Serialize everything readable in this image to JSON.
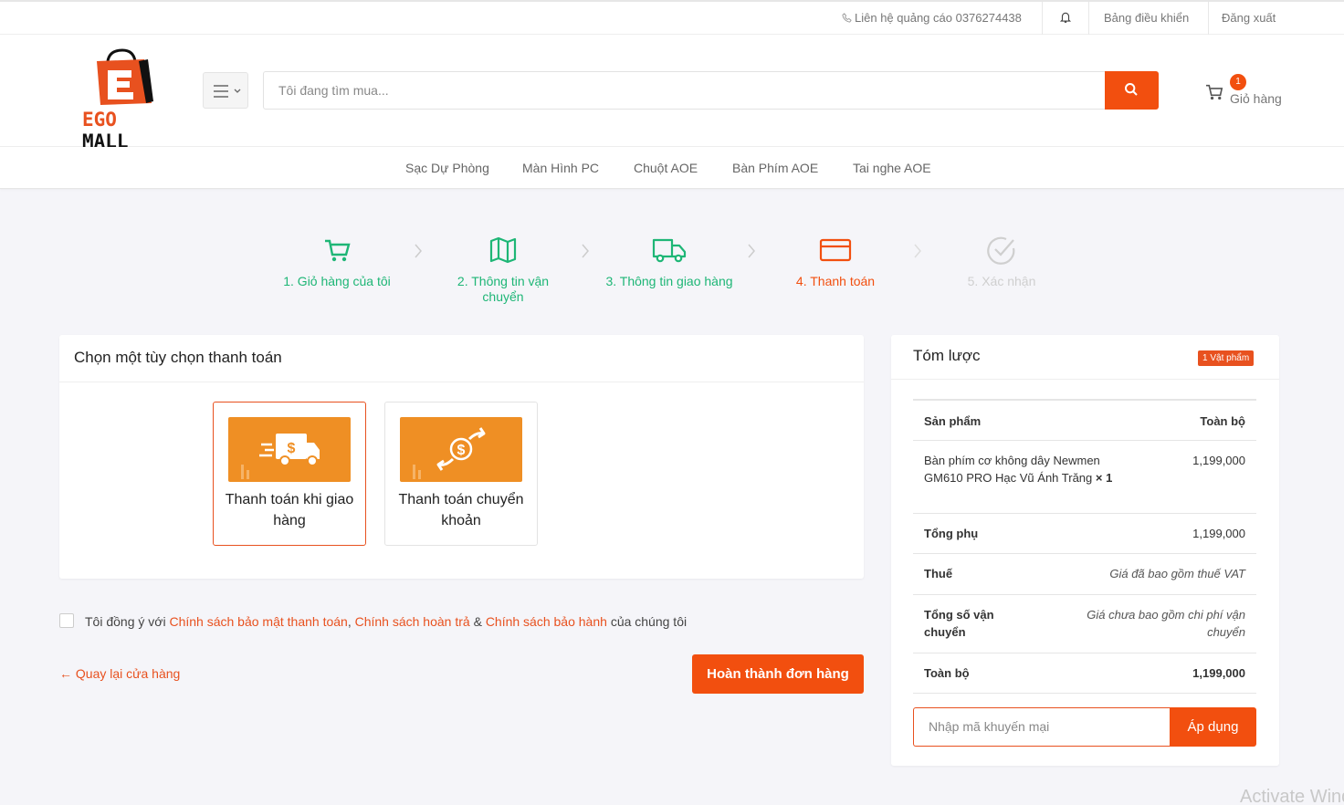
{
  "topbar": {
    "contact": "Liên hệ quảng cáo 0376274438",
    "dashboard": "Bảng điều khiển",
    "logout": "Đăng xuất",
    "icons": [
      "phone-icon",
      "bell-icon"
    ]
  },
  "header": {
    "logo": {
      "brand_a": "EGO",
      "brand_b": "MALL"
    },
    "search": {
      "placeholder": "Tôi đang tìm mua..."
    },
    "cart": {
      "count": "1",
      "label": "Giỏ hàng"
    }
  },
  "nav": {
    "items": [
      "Sạc Dự Phòng",
      "Màn Hình PC",
      "Chuột AOE",
      "Bàn Phím AOE",
      "Tai nghe AOE"
    ]
  },
  "steps": {
    "items": [
      {
        "label": "1. Giỏ hàng của tôi",
        "status": "done",
        "icon": "cart-icon"
      },
      {
        "label": "2. Thông tin vận chuyển",
        "status": "done",
        "icon": "map-icon"
      },
      {
        "label": "3. Thông tin giao hàng",
        "status": "done",
        "icon": "truck-icon"
      },
      {
        "label": "4. Thanh toán",
        "status": "active",
        "icon": "credit-card-icon"
      },
      {
        "label": "5. Xác nhận",
        "status": "pending",
        "icon": "check-circle-icon"
      }
    ]
  },
  "payment": {
    "title": "Chọn một tùy chọn thanh toán",
    "options": [
      {
        "label": "Thanh toán khi giao hàng",
        "selected": true,
        "icon": "cash-truck-icon"
      },
      {
        "label": "Thanh toán chuyển khoản",
        "selected": false,
        "icon": "money-transfer-icon"
      }
    ]
  },
  "agree": {
    "prefix": "Tôi đồng ý với",
    "link1": "Chính sách bảo mật thanh toán",
    "sep1": ",",
    "link2": "Chính sách hoàn trả",
    "sep2": "&",
    "link3": "Chính sách bảo hành",
    "suffix": "của chúng tôi"
  },
  "actions": {
    "back": "Quay lại cửa hàng",
    "finish": "Hoàn thành đơn hàng"
  },
  "summary": {
    "title": "Tóm lược",
    "badge": "1 Vật phẩm",
    "header": {
      "product": "Sản phẩm",
      "total": "Toàn bộ"
    },
    "item": {
      "name": "Bàn phím cơ không dây Newmen GM610 PRO Hạc Vũ Ánh Trăng",
      "qty": "× 1",
      "price": "1,199,000"
    },
    "subtotal": {
      "label": "Tổng phụ",
      "value": "1,199,000"
    },
    "tax": {
      "label": "Thuế",
      "value": "Giá đã bao gồm thuế VAT"
    },
    "shipping": {
      "label": "Tổng số vận chuyển",
      "value": "Giá chưa bao gồm chi phí vận chuyển"
    },
    "total": {
      "label": "Toàn bộ",
      "value": "1,199,000"
    },
    "promo": {
      "placeholder": "Nhập mã khuyến mại",
      "apply": "Áp dụng"
    }
  },
  "watermark": "Activate Windows",
  "colors": {
    "accent": "#f24f0f",
    "done": "#1eb676",
    "pending": "#cfcfcf"
  }
}
